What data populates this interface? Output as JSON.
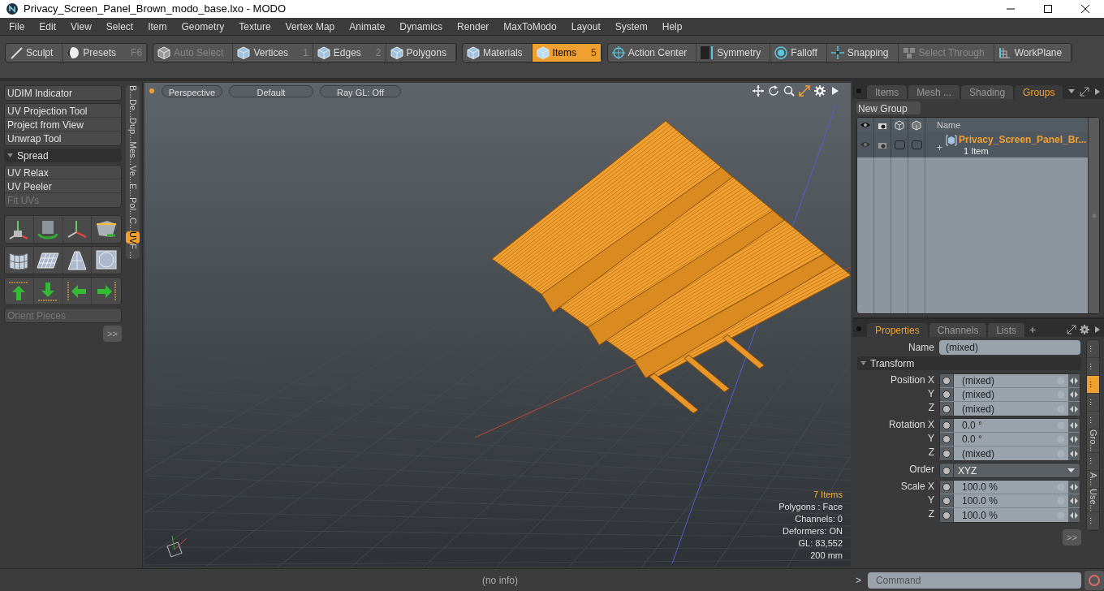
{
  "window": {
    "title": "Privacy_Screen_Panel_Brown_modo_base.lxo - MODO"
  },
  "menu": [
    "File",
    "Edit",
    "View",
    "Select",
    "Item",
    "Geometry",
    "Texture",
    "Vertex Map",
    "Animate",
    "Dynamics",
    "Render",
    "MaxToModo",
    "Layout",
    "System",
    "Help"
  ],
  "toolbar": [
    {
      "buttons": [
        {
          "label": "Sculpt",
          "selected": false,
          "disabled": false
        },
        {
          "label": "Presets",
          "shortcut": "F6",
          "selected": false,
          "disabled": false
        }
      ]
    },
    {
      "buttons": [
        {
          "label": "Auto Select",
          "selected": false,
          "disabled": true
        },
        {
          "label": "Vertices",
          "shortcut": "1",
          "selected": false,
          "disabled": false
        },
        {
          "label": "Edges",
          "shortcut": "2",
          "selected": false,
          "disabled": false
        },
        {
          "label": "Polygons",
          "selected": false,
          "disabled": false
        }
      ]
    },
    {
      "buttons": [
        {
          "label": "Materials",
          "selected": false,
          "disabled": false
        },
        {
          "label": "Items",
          "shortcut": "5",
          "selected": true,
          "disabled": false
        }
      ]
    },
    {
      "buttons": [
        {
          "label": "Action Center",
          "selected": false,
          "disabled": false
        },
        {
          "label": "Symmetry",
          "selected": false,
          "disabled": false
        },
        {
          "label": "Falloff",
          "selected": false,
          "disabled": false
        },
        {
          "label": "Snapping",
          "selected": false,
          "disabled": false
        },
        {
          "label": "Select Through",
          "selected": false,
          "disabled": true
        },
        {
          "label": "WorkPlane",
          "selected": false,
          "disabled": false
        }
      ]
    }
  ],
  "tool_panel": {
    "groups": [
      {
        "kind": "buttons",
        "items": [
          {
            "label": "UDIM Indicator",
            "disabled": false
          }
        ]
      },
      {
        "kind": "buttons",
        "items": [
          {
            "label": "UV Projection Tool",
            "disabled": false
          },
          {
            "label": "Project from View",
            "disabled": false
          },
          {
            "label": "Unwrap Tool",
            "disabled": false
          }
        ]
      },
      {
        "kind": "header",
        "label": "Spread",
        "expanded": true
      },
      {
        "kind": "buttons",
        "items": [
          {
            "label": "UV Relax",
            "disabled": false
          },
          {
            "label": "UV Peeler",
            "disabled": false
          },
          {
            "label": "Fit UVs",
            "disabled": true
          }
        ]
      },
      {
        "kind": "icon_row"
      },
      {
        "kind": "icon_row"
      },
      {
        "kind": "icon_row"
      },
      {
        "kind": "buttons",
        "items": [
          {
            "label": "Orient Pieces",
            "disabled": true
          }
        ]
      }
    ],
    "more_button": ">>",
    "vertical_tabs": [
      {
        "label": "B...",
        "selected": false
      },
      {
        "label": "De...",
        "selected": false
      },
      {
        "label": "Dup...",
        "selected": false
      },
      {
        "label": "Mes...",
        "selected": false
      },
      {
        "label": "Ve...",
        "selected": false
      },
      {
        "label": "E...",
        "selected": false
      },
      {
        "label": "Pol...",
        "selected": false
      },
      {
        "label": "C...",
        "selected": false
      },
      {
        "label": "UV",
        "selected": true
      },
      {
        "label": "F ...",
        "selected": false
      }
    ]
  },
  "viewport": {
    "buttons": [
      "Perspective",
      "Default",
      "Ray GL: Off"
    ],
    "stats": [
      {
        "text": "7 Items",
        "highlight": true
      },
      {
        "text": "Polygons : Face",
        "highlight": false
      },
      {
        "text": "Channels: 0",
        "highlight": false
      },
      {
        "text": "Deformers: ON",
        "highlight": false
      },
      {
        "text": "GL: 83,552",
        "highlight": false
      },
      {
        "text": "200 mm",
        "highlight": false
      }
    ]
  },
  "groups_panel": {
    "tabs": [
      {
        "label": "Items",
        "selected": false
      },
      {
        "label": "Mesh ...",
        "selected": false
      },
      {
        "label": "Shading",
        "selected": false
      },
      {
        "label": "Groups",
        "selected": true
      }
    ],
    "new_group_button": "New Group",
    "name_column": "Name",
    "rows": [
      {
        "name": "Privacy_Screen_Panel_Br...",
        "count": "1 Item",
        "expander": "+",
        "selected": true
      }
    ]
  },
  "properties_panel": {
    "tabs": [
      {
        "label": "Properties",
        "selected": true
      },
      {
        "label": "Channels",
        "selected": false
      },
      {
        "label": "Lists",
        "selected": false
      }
    ],
    "add_tab": "+",
    "name": {
      "label": "Name",
      "value": "(mixed)"
    },
    "section": {
      "label": "Transform",
      "expanded": true
    },
    "groups": [
      {
        "kind": "fields",
        "rows": [
          {
            "label": "Position X",
            "value": "(mixed)"
          },
          {
            "label": "Y",
            "value": "(mixed)"
          },
          {
            "label": "Z",
            "value": "(mixed)"
          }
        ]
      },
      {
        "kind": "fields",
        "rows": [
          {
            "label": "Rotation X",
            "value": "0.0 °"
          },
          {
            "label": "Y",
            "value": "0.0 °"
          },
          {
            "label": "Z",
            "value": "(mixed)"
          }
        ]
      },
      {
        "kind": "dropdown",
        "rows": [
          {
            "label": "Order",
            "value": "XYZ"
          }
        ]
      },
      {
        "kind": "fields",
        "rows": [
          {
            "label": "Scale X",
            "value": "100.0 %"
          },
          {
            "label": "Y",
            "value": "100.0 %"
          },
          {
            "label": "Z",
            "value": "100.0 %"
          }
        ]
      }
    ],
    "more_button": ">>",
    "side_tabs": [
      {
        "label": "...",
        "selected": false
      },
      {
        "label": "...",
        "selected": false
      },
      {
        "label": "...",
        "selected": true
      },
      {
        "label": "...",
        "selected": false
      },
      {
        "label": "...",
        "selected": false
      },
      {
        "label": "Gro...",
        "selected": false
      },
      {
        "label": "...",
        "selected": false
      },
      {
        "label": "A...",
        "selected": false
      },
      {
        "label": "Use...",
        "selected": false
      },
      {
        "label": "...",
        "selected": false
      }
    ]
  },
  "status_bar": {
    "info": "(no info)",
    "prompt": ">",
    "command_placeholder": "Command"
  }
}
